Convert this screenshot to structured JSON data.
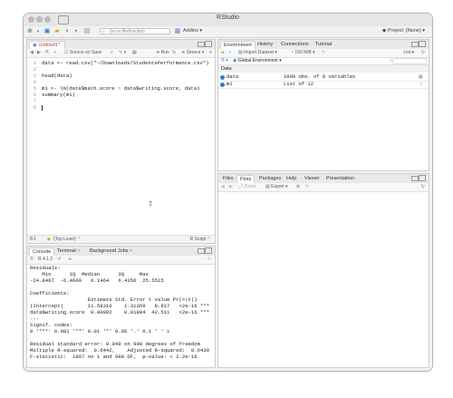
{
  "window": {
    "title": "RStudio"
  },
  "toolbar": {
    "goto_placeholder": "Go to file/function",
    "addins_label": "Addins",
    "project_label": "Project: (None)"
  },
  "editor": {
    "tab_label": "Untitled1*",
    "source_on_save": "Source on Save",
    "run_label": "Run",
    "source_label": "Source",
    "lines": [
      "data <- read.csv(\"~/Downloads/StudentsPerformance.csv\")",
      "",
      "head(data)",
      "",
      "m1 <- lm(data$math.score ~ data$writing.score, data)",
      "summary(m1)",
      "",
      ""
    ],
    "line_numbers": [
      "1",
      "2",
      "3",
      "4",
      "5",
      "6",
      "7",
      "8"
    ],
    "status_position": "8:1",
    "status_level": "(Top Level)",
    "status_type": "R Script"
  },
  "console": {
    "tabs": [
      "Console",
      "Terminal",
      "Background Jobs"
    ],
    "version": "R 4.1.2 · ~/",
    "lines": [
      "Residuals:",
      "    Min      1Q  Median      3Q     Max",
      "-24.8467  -6.4600   0.1464   6.4356  25.5515",
      "",
      "Coefficients:",
      "                   Estimate Std. Error t value Pr(>|t|)",
      "(Intercept)        11.58310    1.31369   8.817   <2e-16 ***",
      "data$writing.score  0.80092    0.01884  42.511   <2e-16 ***",
      "---",
      "Signif. codes:",
      "0 '***' 0.001 '**' 0.01 '*' 0.05 '.' 0.1 ' ' 1",
      "",
      "Residual standard error: 9.049 on 998 degrees of freedom",
      "Multiple R-squared:  0.6442,    Adjusted R-squared:  0.6439",
      "F-statistic:  1807 on 1 and 998 DF,  p-value: < 2.2e-16",
      ""
    ],
    "prompt": ">"
  },
  "environment": {
    "tabs": [
      "Environment",
      "History",
      "Connections",
      "Tutorial"
    ],
    "import_label": "Import Dataset",
    "memory_label": "159 MiB",
    "list_label": "List",
    "scope_label": "Global Environment",
    "section_label": "Data",
    "rows": [
      {
        "name": "data",
        "value": "1000 obs. of 8 variables"
      },
      {
        "name": "m1",
        "value": "List of  12"
      }
    ]
  },
  "files": {
    "tabs": [
      "Files",
      "Plots",
      "Packages",
      "Help",
      "Viewer",
      "Presentation"
    ],
    "zoom_label": "Zoom",
    "export_label": "Export"
  }
}
